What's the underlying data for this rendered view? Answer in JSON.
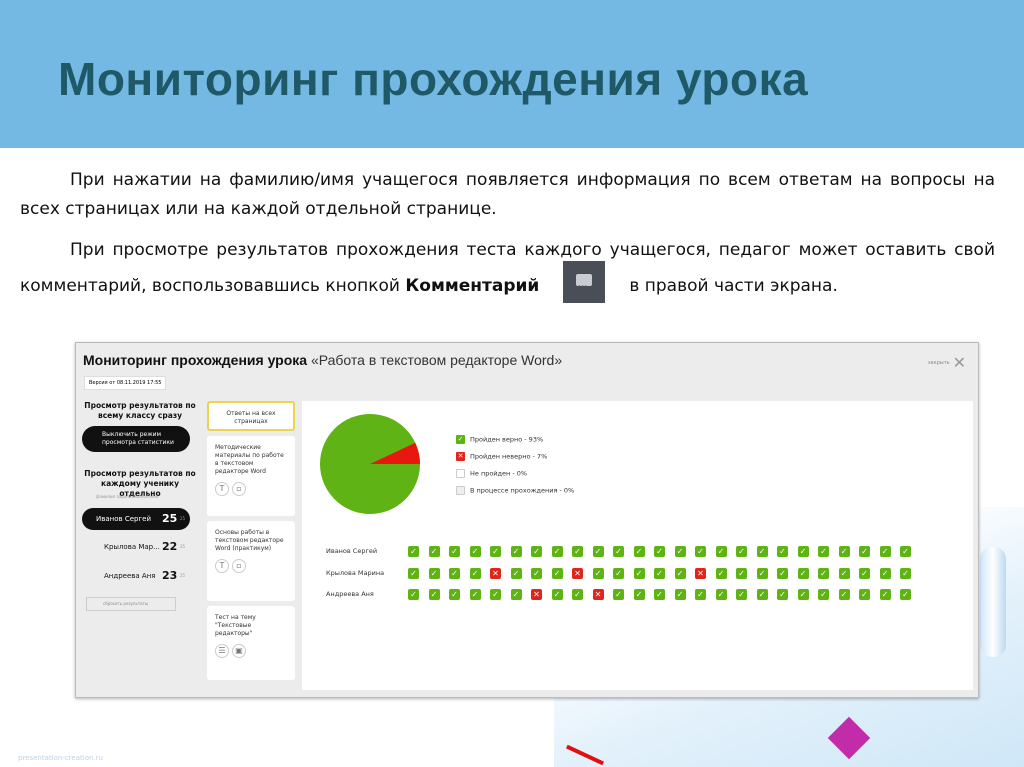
{
  "slide": {
    "title": "Мониторинг прохождения урока",
    "p1": "При нажатии на фамилию/имя учащегося появляется информация по всем ответам на вопросы на всех страницах или на каждой отдельной странице.",
    "p2a": "При просмотре результатов прохождения теста каждого учащегося, педагог может оставить свой комментарий, воспользовавшись кнопкой ",
    "p2b": "Комментарий",
    "p2c": "в правой части экрана.",
    "footer": "presentation-creation.ru"
  },
  "app": {
    "title": "Мониторинг прохождения урока",
    "lesson": "«Работа в текстовом редакторе Word»",
    "version": "Версия от 08.11.2019 17:55",
    "close": "закрыть",
    "whole_class": "Просмотр результатов по всему классу сразу",
    "toggle_stats": "Выключить режим просмотра статистики",
    "each_student": "Просмотр результатов по каждому ученику отдельно",
    "sub_cols": "фамилия     заданий выполнено",
    "students": [
      {
        "name": "Иванов Сергей",
        "score": "25",
        "max": "25"
      },
      {
        "name": "Крылова Мар...",
        "score": "22",
        "max": "25"
      },
      {
        "name": "Андреева Аня",
        "score": "23",
        "max": "25"
      }
    ],
    "reset": "сбросить результаты",
    "cards": [
      {
        "label": "Ответы на всех страницах"
      },
      {
        "label": "Методические материалы по работе в текстовом редакторе Word"
      },
      {
        "label": "Основы работы в текстовом редакторе Word (практикум)"
      },
      {
        "label": "Тест на тему \"Текстовые редакторы\""
      }
    ],
    "legend": [
      {
        "label": "Пройден верно - 93%",
        "color": "#5fb315"
      },
      {
        "label": "Пройден неверно - 7%",
        "color": "#e0261c"
      },
      {
        "label": "Не пройден - 0%",
        "color": "#ffffff"
      },
      {
        "label": "В процессе прохождения - 0%",
        "color": "#eeeeee"
      }
    ],
    "pie": {
      "correct": 93,
      "wrong": 7
    },
    "grid": [
      {
        "name": "Иванов Сергей",
        "wrong": []
      },
      {
        "name": "Крылова Марина",
        "wrong": [
          4,
          8,
          14
        ]
      },
      {
        "name": "Андреева Аня",
        "wrong": [
          6,
          9
        ]
      }
    ],
    "tasks": 25
  }
}
